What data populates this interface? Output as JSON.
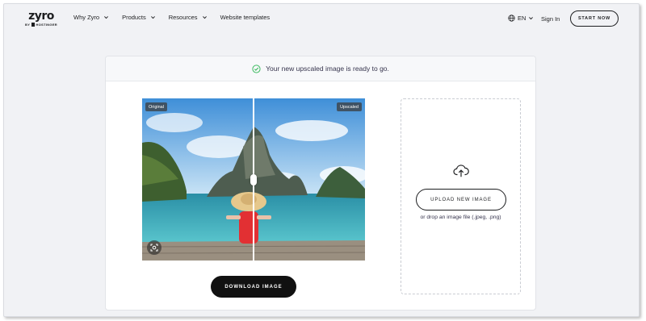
{
  "brand": {
    "name": "zyro",
    "sub": "BY",
    "sub_brand": "HOSTINGER"
  },
  "nav": {
    "items": [
      {
        "label": "Why Zyro",
        "has_menu": true
      },
      {
        "label": "Products",
        "has_menu": true
      },
      {
        "label": "Resources",
        "has_menu": true
      },
      {
        "label": "Website templates",
        "has_menu": false
      }
    ],
    "language": "EN",
    "sign_in": "Sign In",
    "start_now": "START NOW"
  },
  "banner": {
    "message": "Your new upscaled image is ready to go.",
    "status_color": "#3dbb61"
  },
  "compare": {
    "left_label": "Original",
    "right_label": "Upscaled",
    "scan_icon": "scan-icon"
  },
  "download": {
    "label": "DOWNLOAD IMAGE"
  },
  "upload": {
    "button": "UPLOAD NEW IMAGE",
    "hint": "or drop an image file (.jpeg, .png)",
    "icon": "cloud-upload-icon"
  }
}
